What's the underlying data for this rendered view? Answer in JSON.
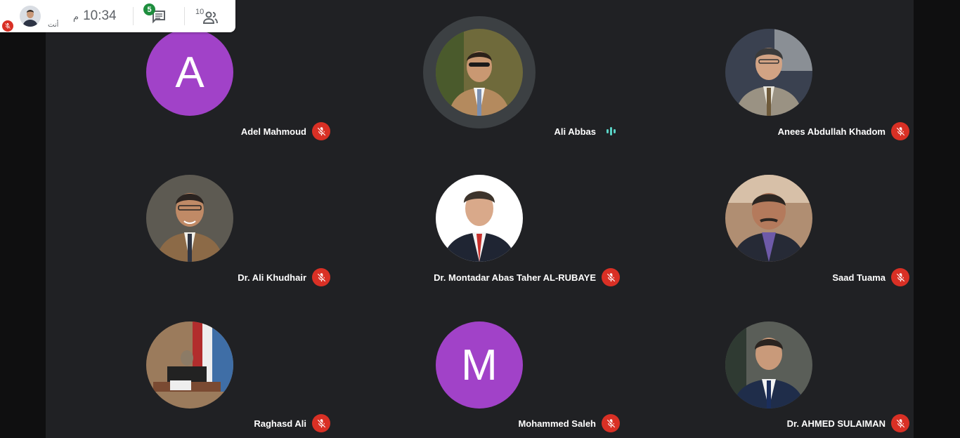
{
  "topbar": {
    "self_label": "أنت",
    "time": "10:34",
    "ampm": "م",
    "chat_badge": "5",
    "people_count": "10"
  },
  "participants": [
    {
      "name": "Adel Mahmoud",
      "avatar_type": "letter",
      "letter": "A",
      "avatar_color": "#a142c8",
      "mic": "muted"
    },
    {
      "name": "Ali Abbas",
      "avatar_type": "photo",
      "mic": "speaking"
    },
    {
      "name": "Anees Abdullah Khadom",
      "avatar_type": "photo",
      "mic": "muted"
    },
    {
      "name": "Dr. Ali Khudhair",
      "avatar_type": "photo",
      "mic": "muted"
    },
    {
      "name": "Dr. Montadar Abas Taher AL-RUBAYE",
      "avatar_type": "photo",
      "mic": "muted"
    },
    {
      "name": "Saad Tuama",
      "avatar_type": "photo",
      "mic": "muted"
    },
    {
      "name": "Raghasd Ali",
      "avatar_type": "photo",
      "mic": "muted"
    },
    {
      "name": "Mohammed Saleh",
      "avatar_type": "letter",
      "letter": "M",
      "avatar_color": "#a142c8",
      "mic": "muted"
    },
    {
      "name": "Dr. AHMED SULAIMAN",
      "avatar_type": "photo",
      "mic": "muted"
    }
  ],
  "colors": {
    "stage_bg": "#202124",
    "mic_muted": "#d93025",
    "speaking": "#5ad2c5",
    "letter_avatar": "#a142c8"
  },
  "icons": [
    "mic-off-icon",
    "audio-wave-icon",
    "chat-icon",
    "people-icon"
  ]
}
